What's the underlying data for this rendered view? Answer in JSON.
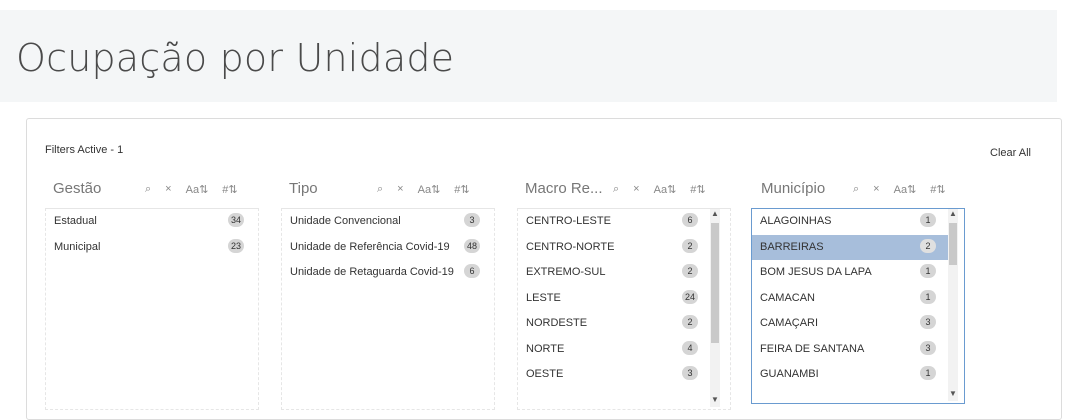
{
  "page": {
    "title": "Ocupação por Unidade"
  },
  "toolbar": {
    "filters_active": "Filters Active - 1",
    "clear_all": "Clear All"
  },
  "icons": {
    "search": "⌕",
    "close": "×",
    "sort_alpha": "Aa⇅",
    "sort_num": "#⇅"
  },
  "filters": [
    {
      "name": "Gestão",
      "items": [
        {
          "label": "Estadual",
          "count": "34"
        },
        {
          "label": "Municipal",
          "count": "23"
        }
      ]
    },
    {
      "name": "Tipo",
      "items": [
        {
          "label": "Unidade Convencional",
          "count": "3"
        },
        {
          "label": "Unidade de Referência Covid-19",
          "count": "48"
        },
        {
          "label": "Unidade de Retaguarda Covid-19",
          "count": "6"
        }
      ]
    },
    {
      "name": "Macro Re...",
      "items": [
        {
          "label": "CENTRO-LESTE",
          "count": "6"
        },
        {
          "label": "CENTRO-NORTE",
          "count": "2"
        },
        {
          "label": "EXTREMO-SUL",
          "count": "2"
        },
        {
          "label": "LESTE",
          "count": "24"
        },
        {
          "label": "NORDESTE",
          "count": "2"
        },
        {
          "label": "NORTE",
          "count": "4"
        },
        {
          "label": "OESTE",
          "count": "3"
        }
      ]
    },
    {
      "name": "Município",
      "selected_index": 1,
      "items": [
        {
          "label": "ALAGOINHAS",
          "count": "1"
        },
        {
          "label": "BARREIRAS",
          "count": "2"
        },
        {
          "label": "BOM JESUS DA LAPA",
          "count": "1"
        },
        {
          "label": "CAMACAN",
          "count": "1"
        },
        {
          "label": "CAMAÇARI",
          "count": "3"
        },
        {
          "label": "FEIRA DE SANTANA",
          "count": "3"
        },
        {
          "label": "GUANAMBI",
          "count": "1"
        }
      ]
    }
  ],
  "colors": {
    "selected_row": "#a7bedb",
    "count_badge": "#d5d5d5",
    "focus_border": "#6a9bd0"
  }
}
